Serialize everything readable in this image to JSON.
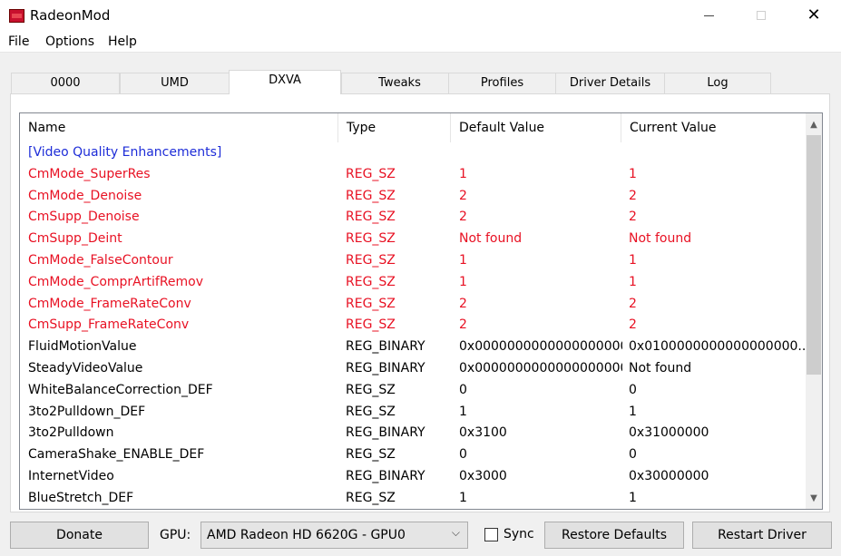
{
  "window": {
    "title": "RadeonMod",
    "minimize_glyph": "",
    "close_glyph": "✕"
  },
  "menu": [
    "File",
    "Options",
    "Help"
  ],
  "tabs": [
    "0000",
    "UMD",
    "DXVA",
    "Tweaks",
    "Profiles",
    "Driver Details",
    "Log"
  ],
  "active_tab": "DXVA",
  "table": {
    "columns": [
      "Name",
      "Type",
      "Default Value",
      "Current Value"
    ],
    "rows": [
      {
        "kind": "section",
        "name": "[Video Quality Enhancements]",
        "type": "",
        "default": "",
        "current": ""
      },
      {
        "kind": "red",
        "name": "CmMode_SuperRes",
        "type": "REG_SZ",
        "default": "1",
        "current": "1"
      },
      {
        "kind": "red",
        "name": "CmMode_Denoise",
        "type": "REG_SZ",
        "default": "2",
        "current": "2"
      },
      {
        "kind": "red",
        "name": "CmSupp_Denoise",
        "type": "REG_SZ",
        "default": "2",
        "current": "2"
      },
      {
        "kind": "red",
        "name": "CmSupp_Deint",
        "type": "REG_SZ",
        "default": "Not found",
        "current": "Not found"
      },
      {
        "kind": "red",
        "name": "CmMode_FalseContour",
        "type": "REG_SZ",
        "default": "1",
        "current": "1"
      },
      {
        "kind": "red",
        "name": "CmMode_ComprArtifRemov",
        "type": "REG_SZ",
        "default": "1",
        "current": "1"
      },
      {
        "kind": "red",
        "name": "CmMode_FrameRateConv",
        "type": "REG_SZ",
        "default": "2",
        "current": "2"
      },
      {
        "kind": "red",
        "name": "CmSupp_FrameRateConv",
        "type": "REG_SZ",
        "default": "2",
        "current": "2"
      },
      {
        "kind": "normal",
        "name": "FluidMotionValue",
        "type": "REG_BINARY",
        "default": "0x0000000000000000000...",
        "current": "0x0100000000000000000..."
      },
      {
        "kind": "normal",
        "name": "SteadyVideoValue",
        "type": "REG_BINARY",
        "default": "0x0000000000000000000...",
        "current": "Not found"
      },
      {
        "kind": "normal",
        "name": "WhiteBalanceCorrection_DEF",
        "type": "REG_SZ",
        "default": "0",
        "current": "0"
      },
      {
        "kind": "normal",
        "name": "3to2Pulldown_DEF",
        "type": "REG_SZ",
        "default": "1",
        "current": "1"
      },
      {
        "kind": "normal",
        "name": "3to2Pulldown",
        "type": "REG_BINARY",
        "default": "0x3100",
        "current": "0x31000000"
      },
      {
        "kind": "normal",
        "name": "CameraShake_ENABLE_DEF",
        "type": "REG_SZ",
        "default": "0",
        "current": "0"
      },
      {
        "kind": "normal",
        "name": "InternetVideo",
        "type": "REG_BINARY",
        "default": "0x3000",
        "current": "0x30000000"
      },
      {
        "kind": "normal",
        "name": "BlueStretch_DEF",
        "type": "REG_SZ",
        "default": "1",
        "current": "1"
      }
    ]
  },
  "scrollbar": {
    "up_glyph": "▲",
    "down_glyph": "▼"
  },
  "bottom": {
    "donate_label": "Donate",
    "gpu_label": "GPU:",
    "gpu_value": "AMD Radeon HD 6620G - GPU0",
    "combo_arrow": "⌵",
    "sync_label": "Sync",
    "sync_checked": false,
    "restore_label": "Restore Defaults",
    "restart_label": "Restart Driver"
  },
  "colors": {
    "section": "#1e2dd8",
    "red_row": "#e81123"
  }
}
